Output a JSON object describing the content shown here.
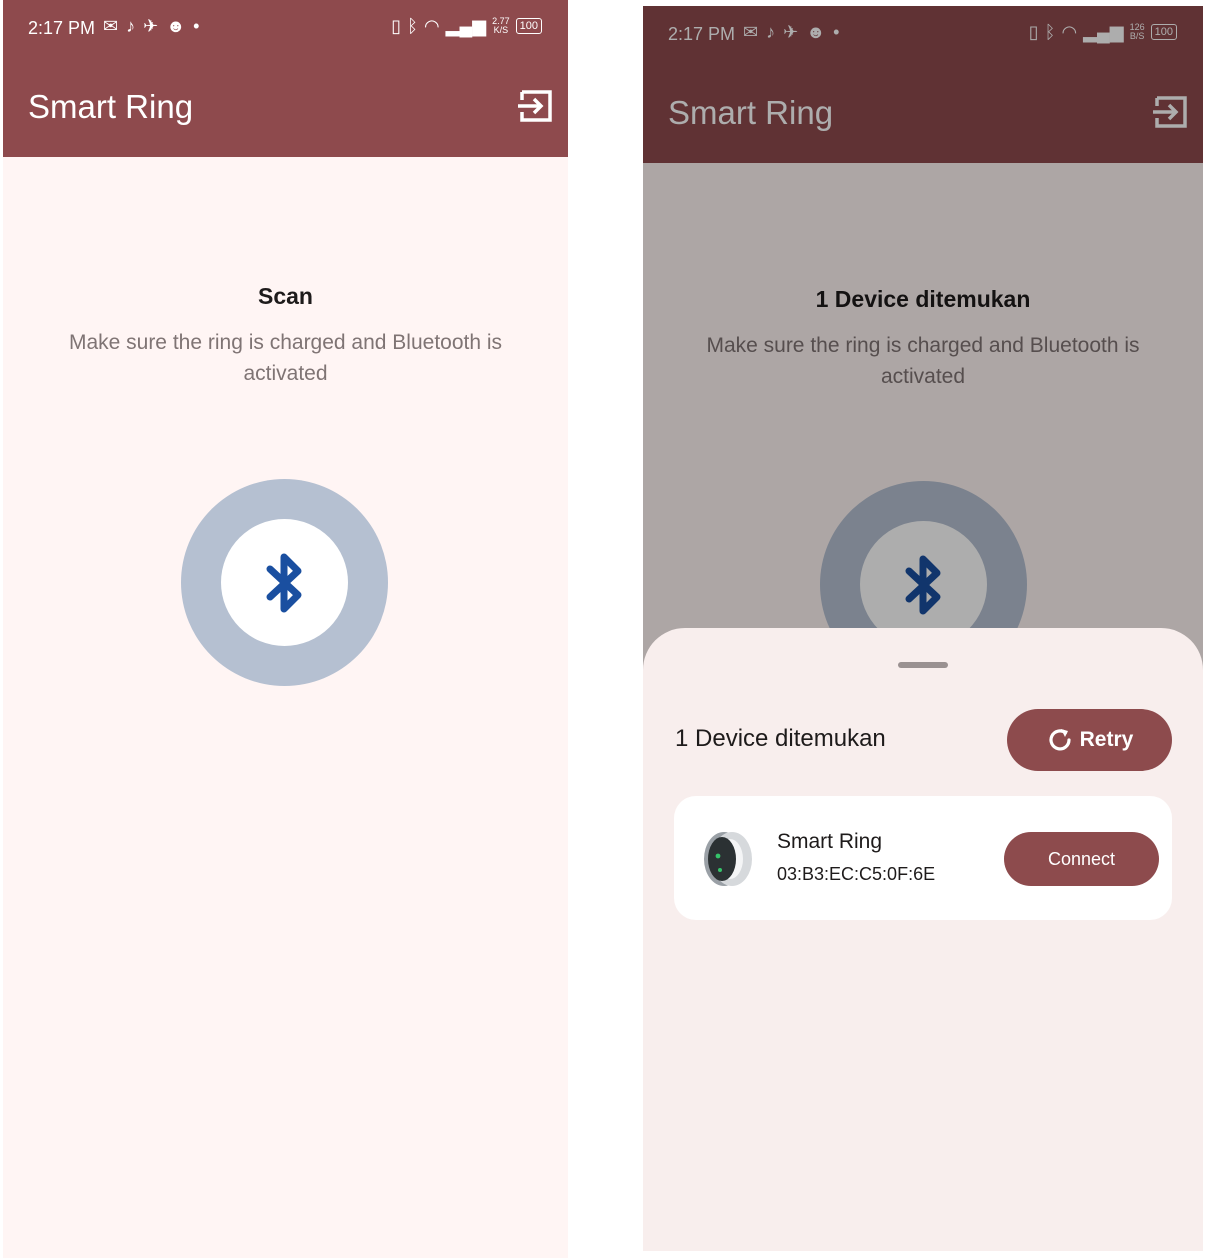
{
  "colors": {
    "appbar": "#8e4a4d",
    "appbar_dimmed": "#602f33",
    "background": "#fff5f4",
    "sheet": "#f8eeed",
    "button": "#8d4b4d",
    "ring": "#b5c0d1",
    "bluetooth_icon": "#1a4fa0"
  },
  "left": {
    "status": {
      "time": "2:17 PM",
      "speed_value": "2.77",
      "speed_unit": "K/S",
      "battery": "100"
    },
    "app_title": "Smart Ring",
    "heading": "Scan",
    "subtext": "Make sure the ring is charged and Bluetooth is activated"
  },
  "right": {
    "status": {
      "time": "2:17 PM",
      "speed_value": "126",
      "speed_unit": "B/S",
      "battery": "100"
    },
    "app_title": "Smart Ring",
    "heading": "1 Device ditemukan",
    "subtext": "Make sure the ring is charged and Bluetooth is activated",
    "sheet": {
      "title": "1 Device ditemukan",
      "retry_label": "Retry",
      "device": {
        "name": "Smart Ring",
        "mac": "03:B3:EC:C5:0F:6E",
        "connect_label": "Connect"
      }
    }
  },
  "icons": {
    "logout": "logout-icon",
    "bluetooth": "bluetooth-icon",
    "retry": "refresh-icon",
    "ring": "smart-ring-image"
  }
}
